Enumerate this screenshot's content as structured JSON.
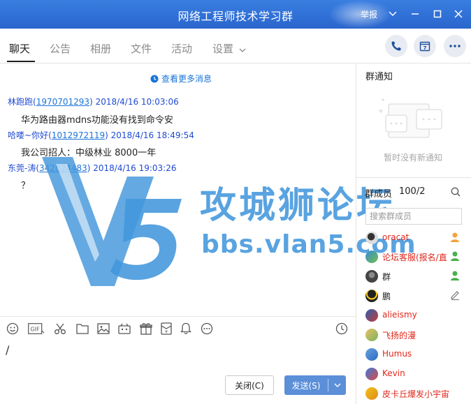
{
  "window": {
    "title": "网络工程师技术学习群",
    "report_label": "举报"
  },
  "tabs": [
    {
      "label": "聊天",
      "active": true
    },
    {
      "label": "公告"
    },
    {
      "label": "相册"
    },
    {
      "label": "文件"
    },
    {
      "label": "活动"
    },
    {
      "label": "设置"
    }
  ],
  "chat": {
    "more_messages": "查看更多消息",
    "messages": [
      {
        "sender": "林跑跑",
        "id": "1970701293",
        "time": "2018/4/16 10:03:06",
        "text": "华为路由器mdns功能没有找到命令安"
      },
      {
        "sender": "哈喽~你好",
        "id": "1012972119",
        "time": "2018/4/16 18:49:54",
        "text": "我公司招人：中级林业 8000一年"
      },
      {
        "sender": "东莞-涛",
        "id": "342824483",
        "time": "2018/4/16 19:03:26",
        "text": "？"
      }
    ]
  },
  "watermark": {
    "text": "攻城狮论坛",
    "url": "bbs.vlan5.com"
  },
  "input": {
    "text": "/",
    "close_label": "关闭(C)",
    "send_label": "发送(S)"
  },
  "notice": {
    "title": "群通知",
    "empty": "暂时没有新通知"
  },
  "members": {
    "title": "群成员",
    "count": "100/2",
    "search_placeholder": "搜索群成员",
    "list": [
      {
        "name": "oracat",
        "color": "#e0261b"
      },
      {
        "name": "论坛客服(报名/直",
        "color": "#e0261b"
      },
      {
        "name": "群",
        "color": "#222222"
      },
      {
        "name": "鹏",
        "color": "#222222"
      },
      {
        "name": "alieismy",
        "color": "#e0261b"
      },
      {
        "name": "飞扬的漫",
        "color": "#e0261b"
      },
      {
        "name": "Humus",
        "color": "#e0261b"
      },
      {
        "name": "Kevin",
        "color": "#e0261b"
      },
      {
        "name": "皮卡丘爆发小宇宙",
        "color": "#e0261b"
      }
    ]
  },
  "colors": {
    "titlebar": "#2f6fd6",
    "link": "#1a74d8",
    "sender": "#1f4bd2",
    "send_button": "#5b8fd8",
    "watermark": "#4296dc"
  }
}
